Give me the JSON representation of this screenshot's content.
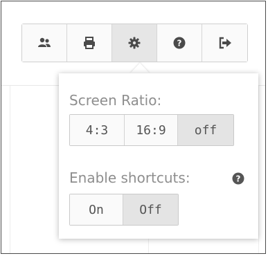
{
  "toolbar": {
    "buttons": [
      {
        "icon": "users-icon",
        "active": false
      },
      {
        "icon": "printer-icon",
        "active": false
      },
      {
        "icon": "gear-icon",
        "active": true
      },
      {
        "icon": "help-icon",
        "active": false
      },
      {
        "icon": "sign-out-icon",
        "active": false
      }
    ]
  },
  "settings": {
    "screen_ratio": {
      "label": "Screen Ratio:",
      "options": [
        "4:3",
        "16:9",
        "off"
      ],
      "selected": "off"
    },
    "shortcuts": {
      "label": "Enable shortcuts:",
      "help_icon": "question-circle-icon",
      "options": [
        "On",
        "Off"
      ],
      "selected": "Off"
    }
  },
  "colors": {
    "icon": "#4a4a4a",
    "label_text": "#8e8e8e",
    "button_text": "#555555",
    "selected_bg": "#e4e4e4",
    "active_tool_bg": "#e6e6e6"
  }
}
